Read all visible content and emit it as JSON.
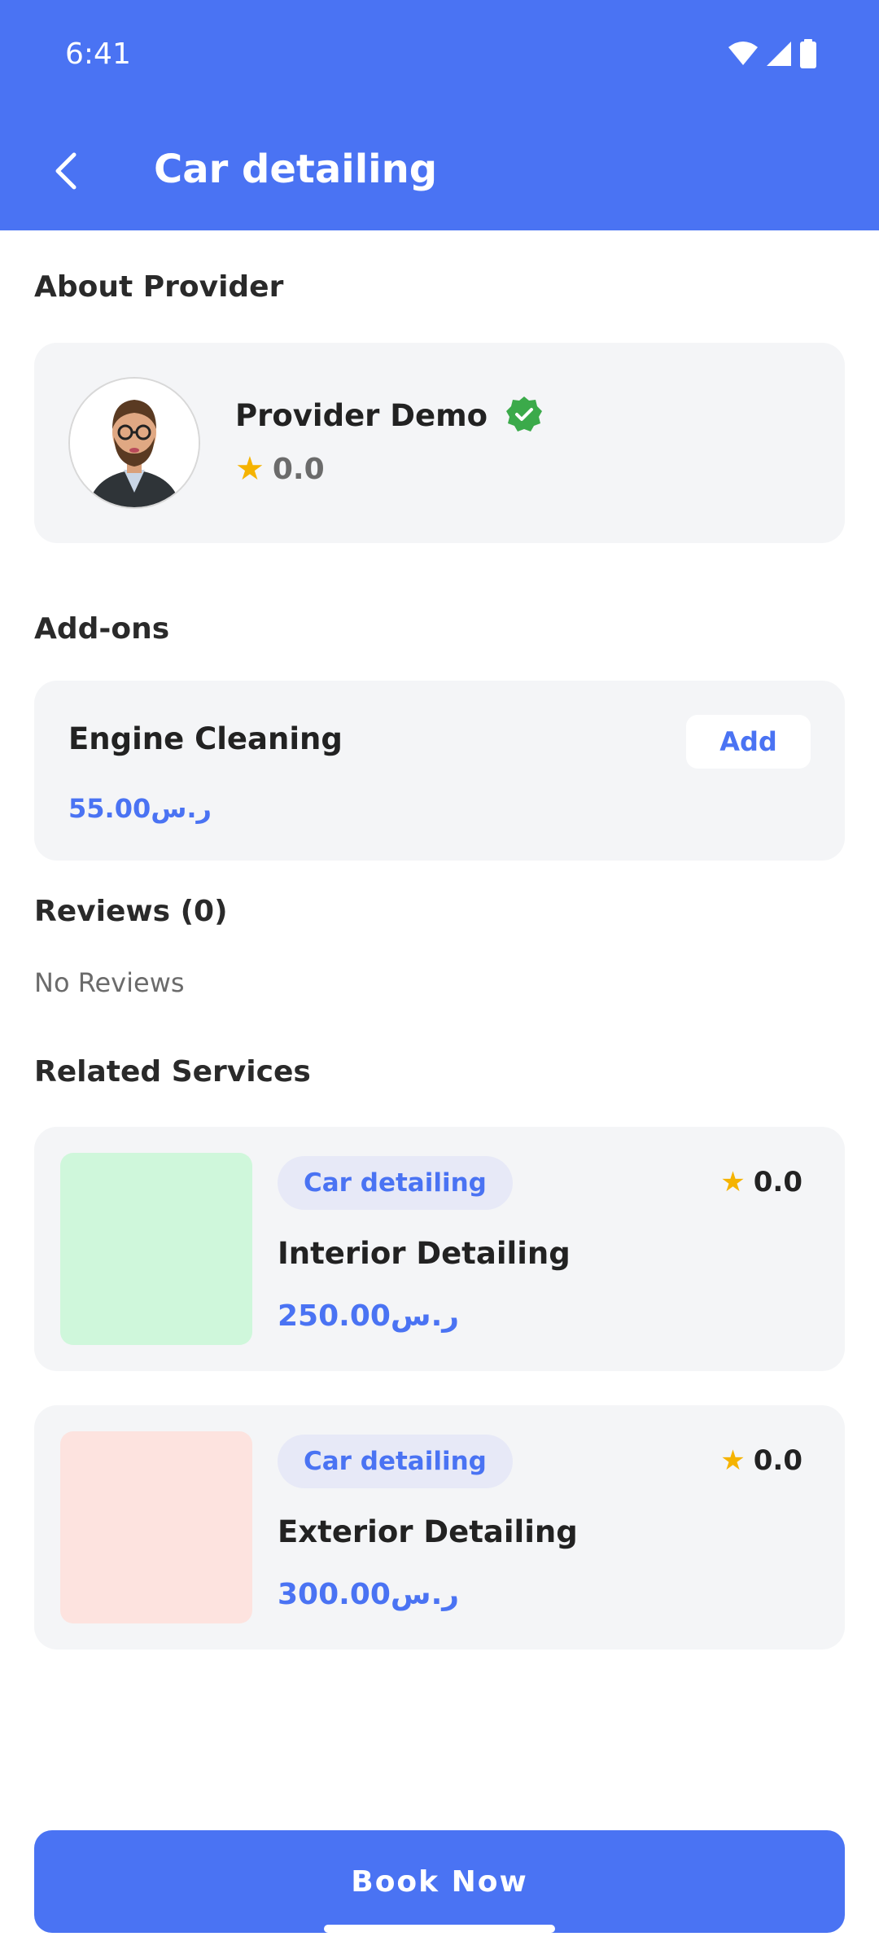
{
  "status_bar": {
    "time": "6:41"
  },
  "appbar": {
    "title": "Car detailing"
  },
  "about_provider": {
    "title": "About Provider",
    "provider_name": "Provider Demo",
    "rating": "0.0"
  },
  "addons": {
    "title": "Add-ons",
    "items": [
      {
        "name": "Engine Cleaning",
        "price": "55.00ر.س",
        "action_label": "Add"
      }
    ]
  },
  "reviews": {
    "title": "Reviews (0)",
    "empty_text": "No Reviews"
  },
  "related_services": {
    "title": "Related Services",
    "items": [
      {
        "category": "Car detailing",
        "name": "Interior Detailing",
        "price": "250.00ر.س",
        "rating": "0.0",
        "thumb_color": "#CFF7DB"
      },
      {
        "category": "Car detailing",
        "name": "Exterior Detailing",
        "price": "300.00ر.س",
        "rating": "0.0",
        "thumb_color": "#FDE3DF"
      }
    ]
  },
  "footer": {
    "book_label": "Book Now"
  },
  "colors": {
    "primary": "#4A73F3",
    "star": "#F5B301",
    "verified": "#3BAA4A",
    "card_bg": "#F4F5F7"
  }
}
